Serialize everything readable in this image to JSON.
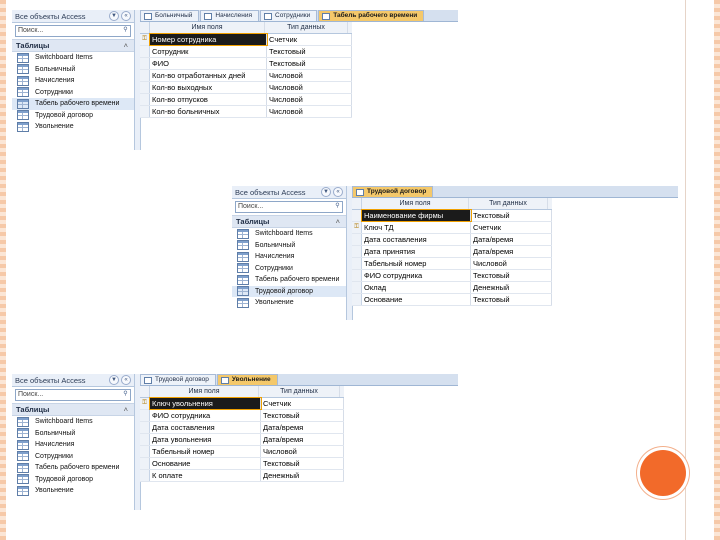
{
  "slide": {
    "accent_color": "#f26a2a",
    "border_color": "#f6c9a8"
  },
  "screens": [
    {
      "nav": {
        "title": "Все объекты Access",
        "search_placeholder": "Поиск...",
        "group": "Таблицы",
        "items": [
          "Switchboard Items",
          "Больничный",
          "Начисления",
          "Сотрудники",
          "Табель рабочего времени",
          "Трудовой договор",
          "Увольнение"
        ],
        "selected": 4
      },
      "tabs": [
        "Больничный",
        "Начисления",
        "Сотрудники",
        "Табель рабочего времени"
      ],
      "active_tab": 3,
      "columns": {
        "name": "Имя поля",
        "type": "Тип данных"
      },
      "rows": [
        {
          "name": "Номер сотрудника",
          "type": "Счетчик",
          "key": true
        },
        {
          "name": "Сотрудник",
          "type": "Текстовый",
          "key": false
        },
        {
          "name": "ФИО",
          "type": "Текстовый",
          "key": false
        },
        {
          "name": "Кол-во отработанных дней",
          "type": "Числовой",
          "key": false
        },
        {
          "name": "Кол-во выходных",
          "type": "Числовой",
          "key": false
        },
        {
          "name": "Кол-во отпусков",
          "type": "Числовой",
          "key": false
        },
        {
          "name": "Кол-во больничных",
          "type": "Числовой",
          "key": false
        }
      ]
    },
    {
      "nav": {
        "title": "Все объекты Access",
        "search_placeholder": "Поиск...",
        "group": "Таблицы",
        "items": [
          "Switchboard Items",
          "Больничный",
          "Начисления",
          "Сотрудники",
          "Табель рабочего времени",
          "Трудовой договор",
          "Увольнение"
        ],
        "selected": 5
      },
      "tabs": [
        "Трудовой договор"
      ],
      "active_tab": 0,
      "columns": {
        "name": "Имя поля",
        "type": "Тип данных"
      },
      "rows": [
        {
          "name": "Наименование фирмы",
          "type": "Текстовый",
          "key": false
        },
        {
          "name": "Ключ ТД",
          "type": "Счетчик",
          "key": true
        },
        {
          "name": "Дата составления",
          "type": "Дата/время",
          "key": false
        },
        {
          "name": "Дата принятия",
          "type": "Дата/время",
          "key": false
        },
        {
          "name": "Табельный номер",
          "type": "Числовой",
          "key": false
        },
        {
          "name": "ФИО сотрудника",
          "type": "Текстовый",
          "key": false
        },
        {
          "name": "Оклад",
          "type": "Денежный",
          "key": false
        },
        {
          "name": "Основание",
          "type": "Текстовый",
          "key": false
        }
      ]
    },
    {
      "nav": {
        "title": "Все объекты Access",
        "search_placeholder": "Поиск...",
        "group": "Таблицы",
        "items": [
          "Switchboard Items",
          "Больничный",
          "Начисления",
          "Сотрудники",
          "Табель рабочего времени",
          "Трудовой договор",
          "Увольнение"
        ],
        "selected": -1
      },
      "tabs": [
        "Трудовой договор",
        "Увольнение"
      ],
      "active_tab": 1,
      "columns": {
        "name": "Имя поля",
        "type": "Тип данных"
      },
      "rows": [
        {
          "name": "Ключ увольнения",
          "type": "Счетчик",
          "key": true
        },
        {
          "name": "ФИО сотрудника",
          "type": "Текстовый",
          "key": false
        },
        {
          "name": "Дата составления",
          "type": "Дата/время",
          "key": false
        },
        {
          "name": "Дата увольнения",
          "type": "Дата/время",
          "key": false
        },
        {
          "name": "Табельный номер",
          "type": "Числовой",
          "key": false
        },
        {
          "name": "Основание",
          "type": "Текстовый",
          "key": false
        },
        {
          "name": "К оплате",
          "type": "Денежный",
          "key": false
        }
      ]
    }
  ]
}
